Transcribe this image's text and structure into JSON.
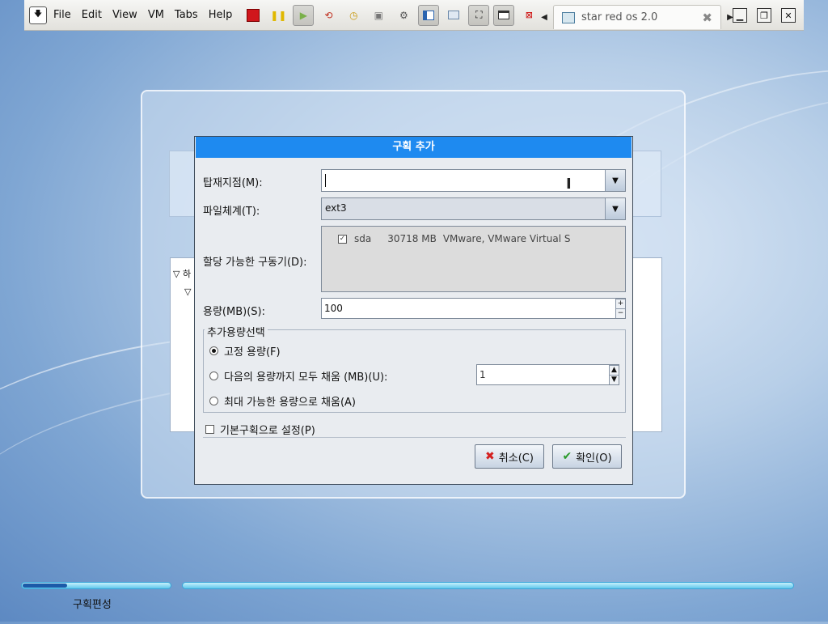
{
  "vm_toolbar": {
    "menu": [
      "File",
      "Edit",
      "View",
      "VM",
      "Tabs",
      "Help"
    ],
    "tab_label": "star red os 2.0",
    "tab_close": "✖"
  },
  "background": {
    "tree_row_1": "▽ 하",
    "tree_row_2": "▽"
  },
  "dialog": {
    "title": "구획 추가",
    "mount_label": "탑재지점(M):",
    "mount_value": "",
    "fs_label": "파일체계(T):",
    "fs_value": "ext3",
    "drives_label": "할당 가능한 구동기(D):",
    "drive_row": {
      "name": "sda",
      "size": "30718 MB",
      "model": "VMware, VMware Virtual S",
      "checked": true
    },
    "size_label": "용량(MB)(S):",
    "size_value": "100",
    "extra_group_title": "추가용량선택",
    "radio_fixed": "고정 용량(F)",
    "radio_fill_upto": "다음의 용량까지 모두 채움 (MB)(U):",
    "fill_upto_value": "1",
    "radio_fill_max": "최대 가능한 용량으로 채움(A)",
    "primary_checkbox": "기본구획으로 설정(P)",
    "cancel_label": "취소(C)",
    "ok_label": "확인(O)"
  },
  "progress": {
    "label": "구획편성",
    "fraction": 0.3
  },
  "icons": [
    "down-arrow-icon",
    "power-off-icon",
    "pause-icon",
    "play-icon",
    "revert-icon",
    "snapshot-icon",
    "snapshot-manager-icon",
    "settings-icon",
    "sidebar-icon",
    "console-icon",
    "fullscreen-icon",
    "unity-icon",
    "shutdown-icon",
    "vm-tab-icon",
    "cursor-ibeam-icon",
    "cancel-x-icon",
    "ok-check-icon"
  ]
}
